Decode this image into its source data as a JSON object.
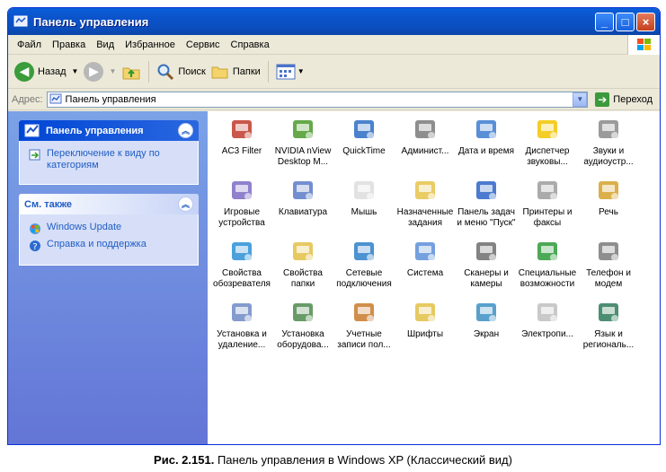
{
  "window": {
    "title": "Панель управления"
  },
  "menu": [
    "Файл",
    "Правка",
    "Вид",
    "Избранное",
    "Сервис",
    "Справка"
  ],
  "toolbar": {
    "back_label": "Назад",
    "search_label": "Поиск",
    "folders_label": "Папки"
  },
  "address": {
    "label": "Адрес:",
    "value": "Панель управления",
    "go_label": "Переход"
  },
  "left_panel": {
    "main_title": "Панель управления",
    "switch_view": "Переключение к виду по категориям",
    "see_also_title": "См. также",
    "links": [
      "Windows Update",
      "Справка и поддержка"
    ]
  },
  "icons": [
    {
      "label1": "AC3 Filter",
      "label2": ""
    },
    {
      "label1": "NVIDIA nView",
      "label2": "Desktop M..."
    },
    {
      "label1": "QuickTime",
      "label2": ""
    },
    {
      "label1": "Админист...",
      "label2": ""
    },
    {
      "label1": "Дата и время",
      "label2": ""
    },
    {
      "label1": "Диспетчер",
      "label2": "звуковы..."
    },
    {
      "label1": "Звуки и",
      "label2": "аудиоустр..."
    },
    {
      "label1": "Игровые",
      "label2": "устройства"
    },
    {
      "label1": "Клавиатура",
      "label2": ""
    },
    {
      "label1": "Мышь",
      "label2": ""
    },
    {
      "label1": "Назначенные",
      "label2": "задания"
    },
    {
      "label1": "Панель задач",
      "label2": "и меню \"Пуск\""
    },
    {
      "label1": "Принтеры и",
      "label2": "факсы"
    },
    {
      "label1": "Речь",
      "label2": ""
    },
    {
      "label1": "Свойства",
      "label2": "обозревателя"
    },
    {
      "label1": "Свойства",
      "label2": "папки"
    },
    {
      "label1": "Сетевые",
      "label2": "подключения"
    },
    {
      "label1": "Система",
      "label2": ""
    },
    {
      "label1": "Сканеры и",
      "label2": "камеры"
    },
    {
      "label1": "Специальные",
      "label2": "возможности"
    },
    {
      "label1": "Телефон и",
      "label2": "модем"
    },
    {
      "label1": "Установка и",
      "label2": "удаление..."
    },
    {
      "label1": "Установка",
      "label2": "оборудова..."
    },
    {
      "label1": "Учетные",
      "label2": "записи пол..."
    },
    {
      "label1": "Шрифты",
      "label2": ""
    },
    {
      "label1": "Экран",
      "label2": ""
    },
    {
      "label1": "Электропи...",
      "label2": ""
    },
    {
      "label1": "Язык и",
      "label2": "региональ..."
    }
  ],
  "icon_names": [
    "ac3filter-icon",
    "nvidia-icon",
    "quicktime-icon",
    "admin-tools-icon",
    "date-time-icon",
    "sound-manager-icon",
    "sounds-audio-icon",
    "game-controllers-icon",
    "keyboard-icon",
    "mouse-icon",
    "scheduled-tasks-icon",
    "taskbar-start-icon",
    "printers-faxes-icon",
    "speech-icon",
    "internet-options-icon",
    "folder-options-icon",
    "network-connections-icon",
    "system-icon",
    "scanners-cameras-icon",
    "accessibility-icon",
    "phone-modem-icon",
    "add-remove-programs-icon",
    "add-hardware-icon",
    "user-accounts-icon",
    "fonts-icon",
    "display-icon",
    "power-options-icon",
    "regional-options-icon"
  ],
  "caption": {
    "bold": "Рис. 2.151.",
    "text": "Панель управления в Windows XP (Классический вид)"
  }
}
